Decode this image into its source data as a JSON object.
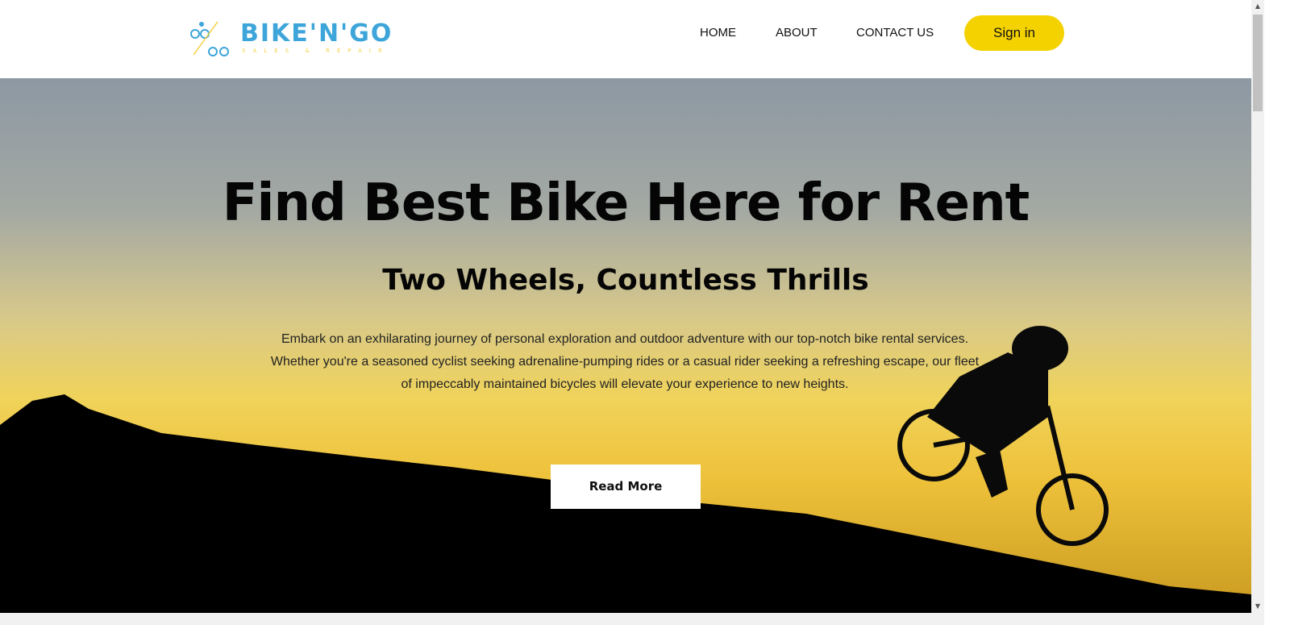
{
  "header": {
    "logo": {
      "text": "BIKE'N'GO",
      "subtitle": "SALES & REPAIR"
    },
    "nav": [
      {
        "label": "HOME"
      },
      {
        "label": "ABOUT"
      },
      {
        "label": "CONTACT US"
      }
    ],
    "sign_in": "Sign in"
  },
  "hero": {
    "title": "Find Best Bike Here for Rent",
    "subtitle": "Two Wheels, Countless Thrills",
    "description": "Embark on an exhilarating journey of personal exploration and outdoor adventure with our top-notch bike rental services. Whether you're a seasoned cyclist seeking adrenaline-pumping rides or a casual rider seeking a refreshing escape, our fleet of impeccably maintained bicycles will elevate your experience to new heights.",
    "read_more": "Read More"
  },
  "colors": {
    "accent": "#f4d200"
  }
}
